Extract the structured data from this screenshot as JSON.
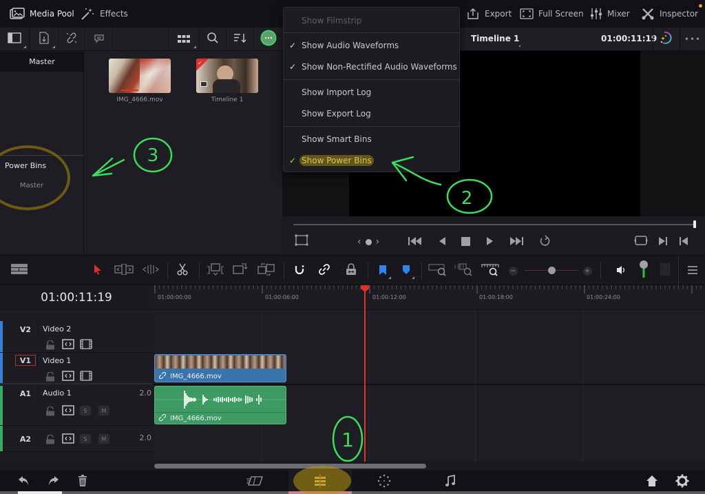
{
  "topbar": {
    "media_pool": "Media Pool",
    "effects": "Effects",
    "export": "Export",
    "full_screen": "Full Screen",
    "mixer": "Mixer",
    "inspector": "Inspector"
  },
  "bins": {
    "master_header": "Master",
    "power_bins_title": "Power Bins",
    "power_bins_master": "Master"
  },
  "media_pool": {
    "clips": [
      {
        "name": "IMG_4666.mov"
      },
      {
        "name": "Timeline 1"
      }
    ]
  },
  "viewer": {
    "timeline_name": "Timeline 1",
    "timecode": "01:00:11:19",
    "scrub_position": 1.0
  },
  "options_menu": {
    "items": [
      {
        "label": "Show Filmstrip",
        "checked": false,
        "disabled": true
      },
      {
        "label": "Show Audio Waveforms",
        "checked": true,
        "disabled": false
      },
      {
        "label": "Show Non-Rectified Audio Waveforms",
        "checked": true,
        "disabled": false
      },
      {
        "label": "Show Import Log",
        "checked": false,
        "disabled": false
      },
      {
        "label": "Show Export Log",
        "checked": false,
        "disabled": false
      },
      {
        "label": "Show Smart Bins",
        "checked": false,
        "disabled": false
      },
      {
        "label": "Show Power Bins",
        "checked": true,
        "disabled": false,
        "highlighted": true
      }
    ],
    "check_glyph": "✓"
  },
  "timeline": {
    "timecode": "01:00:11:19",
    "ruler_labels": [
      "01:00:00:00",
      "01:00:06:00",
      "01:00:12:00",
      "01:00:18:00",
      "01:00:24:00"
    ],
    "zoom_level": 0.5,
    "tracks": [
      {
        "id": "V2",
        "name": "Video 2",
        "type": "video",
        "color": "#3b7fd0"
      },
      {
        "id": "V1",
        "name": "Video 1",
        "type": "video",
        "color": "#3b7fd0",
        "selected": true
      },
      {
        "id": "A1",
        "name": "Audio 1",
        "type": "audio",
        "color": "#3da864",
        "channels": "2.0"
      },
      {
        "id": "A2",
        "name": "",
        "type": "audio",
        "color": "#3da864",
        "channels": "2.0"
      }
    ],
    "track_buttons": {
      "solo": "S",
      "mute": "M"
    },
    "clips": {
      "video": "IMG_4666.mov",
      "audio": "IMG_4666.mov"
    }
  },
  "annotations": {
    "one": "1",
    "two": "2",
    "three": "3"
  },
  "colors": {
    "playhead": "#e0302a",
    "video_clip": "#3b74ad",
    "audio_clip": "#3c9a62",
    "annotation_green": "#3ddc5a",
    "highlight_yellow": "#b8960f"
  }
}
